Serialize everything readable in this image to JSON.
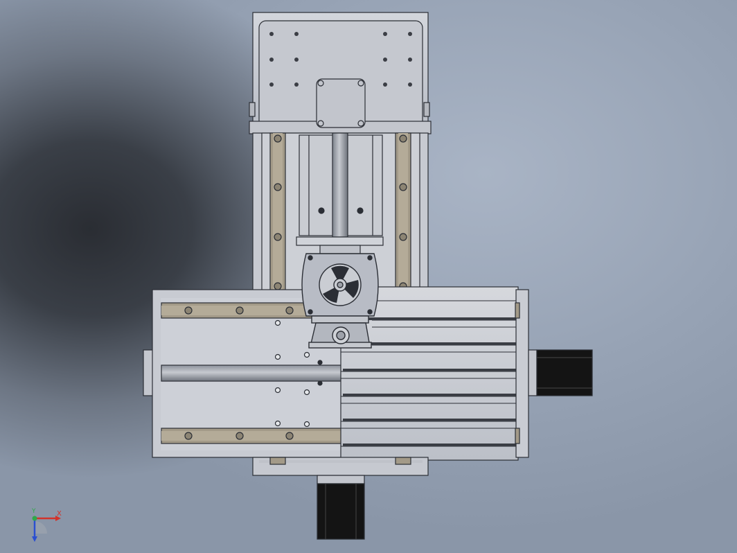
{
  "viewport": {
    "background_dark": "#2a2d33",
    "background_light": "#a9b4c5",
    "part_fill": "#c9ccd3",
    "part_edge": "#2b2e35",
    "rail_fill": "#a39a88",
    "motor_fill": "#141414"
  },
  "axis_triad": {
    "x_label": "X",
    "y_label": "Y",
    "x_color": "#d2332b",
    "y_color": "#2fa84a",
    "z_color": "#2b4fd1"
  }
}
